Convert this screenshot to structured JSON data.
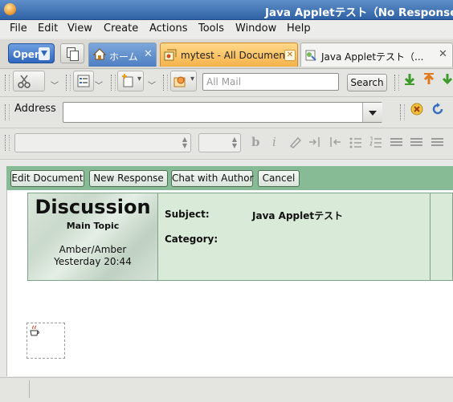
{
  "window": {
    "title": "Java Appletテスト（No Response）"
  },
  "menu": [
    "File",
    "Edit",
    "View",
    "Create",
    "Actions",
    "Tools",
    "Window",
    "Help"
  ],
  "tabs": {
    "open_label": "Open",
    "home_label": "ホーム",
    "mytest_label": "mytest - All Documents",
    "java_label": "Java Appletテスト（...",
    "close_glyph": "✕"
  },
  "toolbar": {
    "search_placeholder": "All Mail",
    "search_button": "Search"
  },
  "address": {
    "label": "Address",
    "value": ""
  },
  "format": {
    "bold": "b",
    "italic": "i"
  },
  "actions": [
    "Edit Document",
    "New Response",
    "Chat with Author",
    "Cancel"
  ],
  "document": {
    "title": "Discussion",
    "subtitle": "Main Topic",
    "author": "Amber/Amber",
    "date": "Yesterday 20:44",
    "subject_label": "Subject:",
    "subject_value": "Java Appletテスト",
    "category_label": "Category:"
  },
  "colors": {
    "titlebar": "#2f62a6",
    "actionbar": "#86bb95",
    "header_bg": "#d9ead9",
    "mytest_tab": "#f5b24a"
  }
}
